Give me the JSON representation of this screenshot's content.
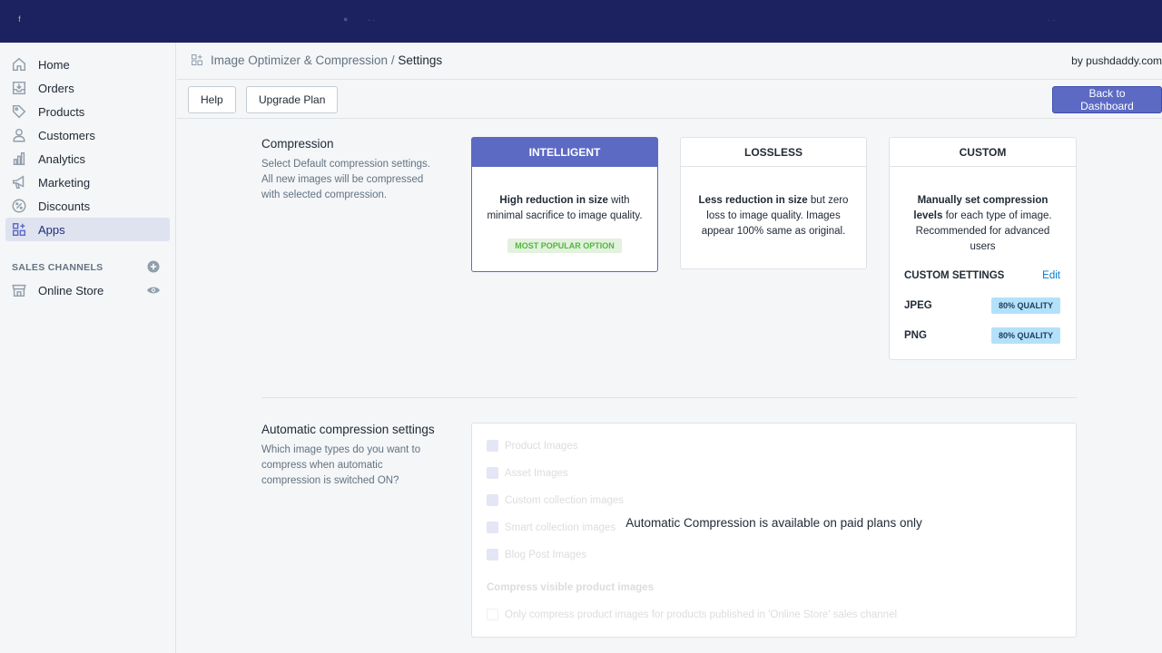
{
  "topbar": {
    "logo_glyph": "ᶠ"
  },
  "sidebar": {
    "items": [
      {
        "label": "Home",
        "icon": "home-icon"
      },
      {
        "label": "Orders",
        "icon": "orders-icon"
      },
      {
        "label": "Products",
        "icon": "tag-icon"
      },
      {
        "label": "Customers",
        "icon": "person-icon"
      },
      {
        "label": "Analytics",
        "icon": "bar-chart-icon"
      },
      {
        "label": "Marketing",
        "icon": "megaphone-icon"
      },
      {
        "label": "Discounts",
        "icon": "discount-icon"
      },
      {
        "label": "Apps",
        "icon": "apps-icon",
        "active": true
      }
    ],
    "sales_channels_title": "SALES CHANNELS",
    "online_store": "Online Store"
  },
  "header": {
    "app_name": "Image Optimizer & Compression",
    "separator": "/",
    "page": "Settings",
    "by": "by pushdaddy.com"
  },
  "toolbar": {
    "help": "Help",
    "upgrade": "Upgrade Plan",
    "back": "Back to Dashboard"
  },
  "compression": {
    "title": "Compression",
    "description": "Select Default compression settings. All new images will be compressed with selected compression.",
    "intelligent": {
      "title": "INTELLIGENT",
      "bold": "High reduction in size",
      "text": " with minimal sacrifice to image quality.",
      "badge": "MOST POPULAR OPTION"
    },
    "lossless": {
      "title": "LOSSLESS",
      "bold": "Less reduction in size",
      "text": " but zero loss to image quality. Images appear 100% same as original."
    },
    "custom": {
      "title": "CUSTOM",
      "bold": "Manually set compression levels",
      "text": " for each type of image. Recommended for advanced users",
      "settings_label": "CUSTOM SETTINGS",
      "edit": "Edit",
      "jpeg_label": "JPEG",
      "jpeg_quality": "80% QUALITY",
      "png_label": "PNG",
      "png_quality": "80% QUALITY"
    }
  },
  "automatic": {
    "title": "Automatic compression settings",
    "description": "Which image types do you want to compress when automatic compression is switched ON?",
    "options": [
      "Product Images",
      "Asset Images",
      "Custom collection images",
      "Smart collection images",
      "Blog Post Images"
    ],
    "visible_title": "Compress visible product images",
    "visible_option": "Only compress product images for products published in 'Online Store' sales channel",
    "message": "Automatic Compression is available on paid plans only"
  },
  "colors": {
    "topbar": "#1c2260",
    "accent": "#5c6ac4",
    "popular_text": "#50b83c",
    "quality_badge": "#b4e1fa",
    "link": "#007ace"
  }
}
